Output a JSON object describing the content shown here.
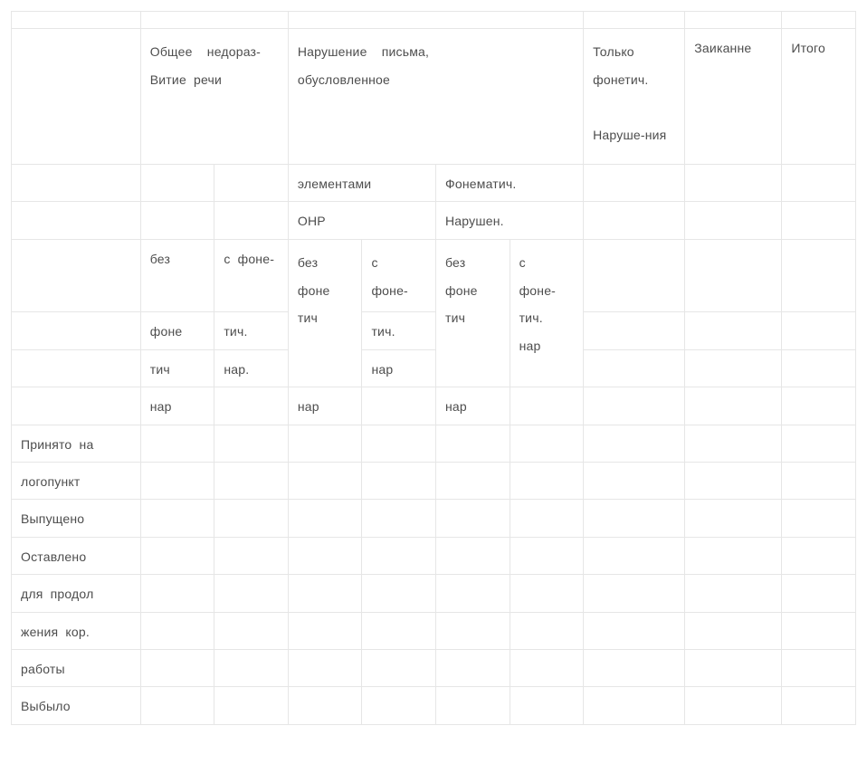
{
  "header": {
    "col_b": "Общее недораз-\nВитие речи",
    "col_c": "Нарушение письма, обусловленное",
    "col_d": "Только фонетич.\nНаруше-ния",
    "col_e": "Заиканне",
    "col_f": "Итого"
  },
  "sub": {
    "elem": "элементами",
    "fonem": "Фонематич.",
    "onr": "ОНР",
    "narushen": "Нарушен."
  },
  "split": {
    "bez": "без",
    "s_fone": "с фоне-",
    "fone": "фоне",
    "tich_dot": "тич.",
    "tich": "тич",
    "nar_dot": "нар.",
    "nar": "нар",
    "bez_fone_tich": "без фоне тич",
    "s_fone_tich_dot": "с фоне-тич.",
    "s_fone_tich_dot_nar": "с фоне-тич. нар"
  },
  "rows": {
    "r1a": "Принято на",
    "r1b": "логопункт",
    "r2": "Выпущено",
    "r3": "Оставлено",
    "r4a": "для продол",
    "r4b": "жения кор.",
    "r4c": "работы",
    "r5": "Выбыло"
  }
}
